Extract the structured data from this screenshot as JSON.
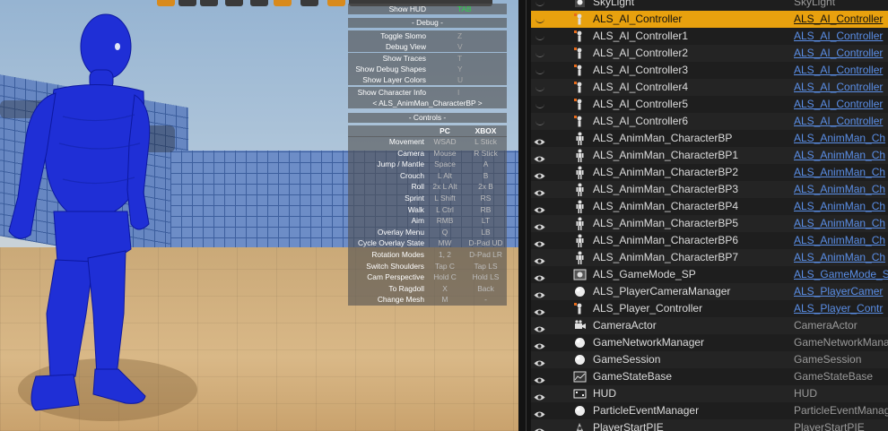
{
  "debug_menu": {
    "show_hud": {
      "label": "Show HUD",
      "key": "TAB"
    },
    "debug_header": "- Debug -",
    "debug_items": [
      {
        "label": "Toggle Slomo",
        "key": "Z"
      },
      {
        "label": "Debug View",
        "key": "V"
      },
      {
        "label": "Show Traces",
        "key": "T"
      },
      {
        "label": "Show Debug Shapes",
        "key": "Y"
      },
      {
        "label": "Show Layer Colors",
        "key": "U"
      }
    ],
    "show_character_info": {
      "label": "Show Character Info",
      "key": "I"
    },
    "character_selector": "<   ALS_AnimMan_CharacterBP   >",
    "controls_header": "- Controls -",
    "col_pc": "PC",
    "col_xbox": "XBOX",
    "controls": [
      {
        "action": "Movement",
        "pc": "WSAD",
        "xbox": "L Stick"
      },
      {
        "action": "Camera",
        "pc": "Mouse",
        "xbox": "R Stick"
      },
      {
        "action": "Jump / Mantle",
        "pc": "Space",
        "xbox": "A"
      },
      {
        "action": "Crouch",
        "pc": "L Alt",
        "xbox": "B"
      },
      {
        "action": "Roll",
        "pc": "2x L Alt",
        "xbox": "2x B"
      },
      {
        "action": "Sprint",
        "pc": "L Shift",
        "xbox": "RS"
      },
      {
        "action": "Walk",
        "pc": "L Ctrl",
        "xbox": "RB"
      },
      {
        "action": "Aim",
        "pc": "RMB",
        "xbox": "LT"
      },
      {
        "action": "Overlay Menu",
        "pc": "Q",
        "xbox": "LB"
      },
      {
        "action": "Cycle Overlay State",
        "pc": "MW",
        "xbox": "D-Pad UD"
      },
      {
        "action": "Rotation Modes",
        "pc": "1, 2",
        "xbox": "D-Pad LR"
      },
      {
        "action": "Switch Shoulders",
        "pc": "Tap C",
        "xbox": "Tap LS"
      },
      {
        "action": "Cam Perspective",
        "pc": "Hold C",
        "xbox": "Hold LS"
      },
      {
        "action": "To Ragdoll",
        "pc": "X",
        "xbox": "Back"
      },
      {
        "action": "Change Mesh",
        "pc": "M",
        "xbox": "-"
      }
    ]
  },
  "outliner": {
    "rows": [
      {
        "name": "SkyLight",
        "type": "SkyLight",
        "icon": "skylight-icon",
        "link": false,
        "eye": false
      },
      {
        "name": "ALS_AI_Controller",
        "type": "ALS_AI_Controller",
        "icon": "controller-icon",
        "link": true,
        "eye": false,
        "selected": true
      },
      {
        "name": "ALS_AI_Controller1",
        "type": "ALS_AI_Controller",
        "icon": "controller-icon",
        "link": true,
        "eye": false
      },
      {
        "name": "ALS_AI_Controller2",
        "type": "ALS_AI_Controller",
        "icon": "controller-icon",
        "link": true,
        "eye": false
      },
      {
        "name": "ALS_AI_Controller3",
        "type": "ALS_AI_Controller",
        "icon": "controller-icon",
        "link": true,
        "eye": false
      },
      {
        "name": "ALS_AI_Controller4",
        "type": "ALS_AI_Controller",
        "icon": "controller-icon",
        "link": true,
        "eye": false
      },
      {
        "name": "ALS_AI_Controller5",
        "type": "ALS_AI_Controller",
        "icon": "controller-icon",
        "link": true,
        "eye": false
      },
      {
        "name": "ALS_AI_Controller6",
        "type": "ALS_AI_Controller",
        "icon": "controller-icon",
        "link": true,
        "eye": false
      },
      {
        "name": "ALS_AnimMan_CharacterBP",
        "type": "ALS_AnimMan_Ch",
        "icon": "character-icon",
        "link": true,
        "eye": true
      },
      {
        "name": "ALS_AnimMan_CharacterBP1",
        "type": "ALS_AnimMan_Ch",
        "icon": "character-icon",
        "link": true,
        "eye": true
      },
      {
        "name": "ALS_AnimMan_CharacterBP2",
        "type": "ALS_AnimMan_Ch",
        "icon": "character-icon",
        "link": true,
        "eye": true
      },
      {
        "name": "ALS_AnimMan_CharacterBP3",
        "type": "ALS_AnimMan_Ch",
        "icon": "character-icon",
        "link": true,
        "eye": true
      },
      {
        "name": "ALS_AnimMan_CharacterBP4",
        "type": "ALS_AnimMan_Ch",
        "icon": "character-icon",
        "link": true,
        "eye": true
      },
      {
        "name": "ALS_AnimMan_CharacterBP5",
        "type": "ALS_AnimMan_Ch",
        "icon": "character-icon",
        "link": true,
        "eye": true
      },
      {
        "name": "ALS_AnimMan_CharacterBP6",
        "type": "ALS_AnimMan_Ch",
        "icon": "character-icon",
        "link": true,
        "eye": true
      },
      {
        "name": "ALS_AnimMan_CharacterBP7",
        "type": "ALS_AnimMan_Ch",
        "icon": "character-icon",
        "link": true,
        "eye": true
      },
      {
        "name": "ALS_GameMode_SP",
        "type": "ALS_GameMode_S",
        "icon": "gamemode-icon",
        "link": true,
        "eye": true
      },
      {
        "name": "ALS_PlayerCameraManager",
        "type": "ALS_PlayerCamer",
        "icon": "sphere-icon",
        "link": true,
        "eye": true
      },
      {
        "name": "ALS_Player_Controller",
        "type": "ALS_Player_Contr",
        "icon": "controller-icon",
        "link": true,
        "eye": true
      },
      {
        "name": "CameraActor",
        "type": "CameraActor",
        "icon": "camera-icon",
        "link": false,
        "eye": true
      },
      {
        "name": "GameNetworkManager",
        "type": "GameNetworkMana",
        "icon": "sphere-icon",
        "link": false,
        "eye": true
      },
      {
        "name": "GameSession",
        "type": "GameSession",
        "icon": "sphere-icon",
        "link": false,
        "eye": true
      },
      {
        "name": "GameStateBase",
        "type": "GameStateBase",
        "icon": "gamestate-icon",
        "link": false,
        "eye": true
      },
      {
        "name": "HUD",
        "type": "HUD",
        "icon": "hud-icon",
        "link": false,
        "eye": true
      },
      {
        "name": "ParticleEventManager",
        "type": "ParticleEventManag",
        "icon": "sphere-icon",
        "link": false,
        "eye": true
      },
      {
        "name": "PlayerStartPIE",
        "type": "PlayerStartPIE",
        "icon": "playerstart-icon",
        "link": false,
        "eye": true
      }
    ]
  },
  "colors": {
    "selection": "#e8a10e",
    "link": "#5a8ee6",
    "character": "#1f2fd6"
  }
}
